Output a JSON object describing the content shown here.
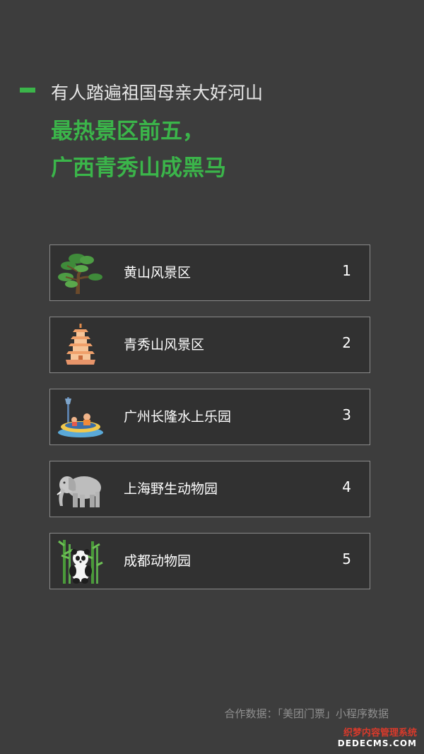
{
  "header": {
    "subtitle": "有人踏遍祖国母亲大好河山",
    "headline_line1": "最热景区前五，",
    "headline_line2": "广西青秀山成黑马",
    "accent_color": "#3bb54a"
  },
  "ranking": [
    {
      "name": "黄山风景区",
      "rank": "1",
      "icon": "pine-tree-icon"
    },
    {
      "name": "青秀山风景区",
      "rank": "2",
      "icon": "pagoda-icon"
    },
    {
      "name": "广州长隆水上乐园",
      "rank": "3",
      "icon": "water-park-raft-icon"
    },
    {
      "name": "上海野生动物园",
      "rank": "4",
      "icon": "elephant-icon"
    },
    {
      "name": "成都动物园",
      "rank": "5",
      "icon": "panda-bamboo-icon"
    }
  ],
  "footer": {
    "source": "合作数据：「美团门票」小程序数据"
  },
  "watermark": {
    "line1": "织梦内容管理系统",
    "line2": "DEDECMS.COM"
  }
}
